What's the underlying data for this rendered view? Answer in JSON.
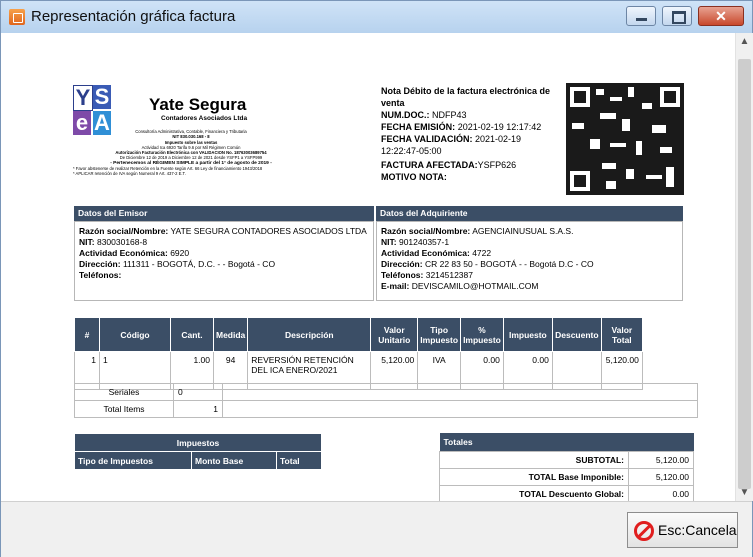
{
  "window": {
    "title": "Representación gráfica factura"
  },
  "footer": {
    "cancel_label": "Esc:Cancela"
  },
  "logo": {
    "letters": [
      "Y",
      "S",
      "e",
      "A"
    ],
    "name": "Yate Segura",
    "subtitle": "Contadores Asociados Ltda",
    "lines": [
      "Consultoría Administrativa, Contable, Financiera y Tributaria",
      "NIT 830.030.168 - 8",
      "Impuesto sobre las ventas",
      "Actividad Ica 6920 Tarifa 9.6 por Mil Régimen Común",
      "Autorización Facturación Electrónica con VALIDACION No. 18763003689754",
      "De Diciembre 12 de 2019 a Diciembre 12 de 2021 desde YSFP1 a YSFP999",
      "- Pertenecemos al RÉGIMEN SIMPLE a partir del 1° de agosto de 2019 -",
      "* Favor abstenerse de realizar Retención en la Fuente según Art. 66 Ley de financiamiento 1943/2018",
      "* APLICAR retención de IVA según Numeral 9 Art. 437-2 E.T."
    ]
  },
  "invoice": {
    "heading": "Nota Débito de la factura electrónica de venta",
    "num_label": "NUM.DOC.:",
    "num_value": "NDFP43",
    "emission_label": "FECHA EMISIÓN:",
    "emission_value": "2021-02-19 12:17:42",
    "validation_label": "FECHA VALIDACIÓN:",
    "validation_value": "2021-02-19 12:22:47-05:00",
    "affected_label": "FACTURA AFECTADA:",
    "affected_value": "YSFP626",
    "motive_label": "MOTIVO NOTA:"
  },
  "emisor": {
    "header": "Datos del Emisor",
    "razon_label": "Razón social/Nombre:",
    "razon_value": "YATE SEGURA CONTADORES ASOCIADOS LTDA",
    "nit_label": "NIT:",
    "nit_value": "830030168-8",
    "actividad_label": "Actividad Económica:",
    "actividad_value": "6920",
    "direccion_label": "Dirección:",
    "direccion_value": "111311 - BOGOTÁ, D.C. - - Bogotá - CO",
    "telefonos_label": "Teléfonos:"
  },
  "adquiriente": {
    "header": "Datos del Adquiriente",
    "razon_label": "Razón social/Nombre:",
    "razon_value": "AGENCIAINUSUAL S.A.S.",
    "nit_label": "NIT:",
    "nit_value": "901240357-1",
    "actividad_label": "Actividad Económica:",
    "actividad_value": "4722",
    "direccion_label": "Dirección:",
    "direccion_value": "CR 22 83 50 - BOGOTÁ - - Bogotá D.C - CO",
    "telefonos_label": "Teléfonos:",
    "telefonos_value": "3214512387",
    "email_label": "E-mail:",
    "email_value": "DEVISCAMILO@HOTMAIL.COM"
  },
  "items": {
    "headers": [
      "#",
      "Código",
      "Cant.",
      "Medida",
      "Descripción",
      "Valor Unitario",
      "Tipo Impuesto",
      "% Impuesto",
      "Impuesto",
      "Descuento",
      "Valor Total"
    ],
    "row": [
      "1",
      "1",
      "1.00",
      "94",
      "REVERSIÓN RETENCIÓN DEL ICA ENERO/2021",
      "5,120.00",
      "IVA",
      "0.00",
      "0.00",
      "",
      "5,120.00"
    ]
  },
  "serials": {
    "label": "Seriales",
    "value": "0",
    "total_label": "Total Items",
    "total_value": "1"
  },
  "impuestos": {
    "header": "Impuestos",
    "cols": [
      "Tipo de Impuestos",
      "Monto Base",
      "Total"
    ]
  },
  "totales": {
    "header": "Totales",
    "rows": [
      {
        "label": "SUBTOTAL:",
        "value": "5,120.00"
      },
      {
        "label": "TOTAL Base Imponible:",
        "value": "5,120.00"
      },
      {
        "label": "TOTAL Descuento Global:",
        "value": "0.00"
      }
    ]
  },
  "colors": {
    "header_bg": "#3b4e66",
    "close_red": "#c8482c",
    "cancel_red": "#e01e1e"
  }
}
